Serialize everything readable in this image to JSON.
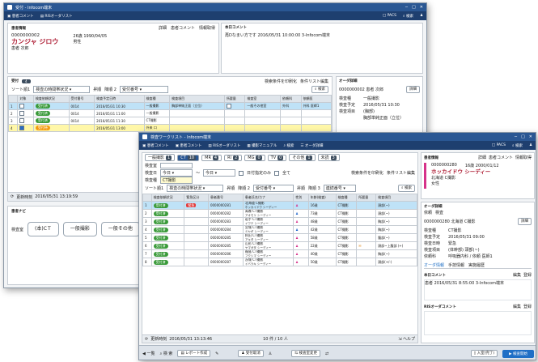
{
  "back": {
    "title": "受付 - Infocom端末",
    "toolbar": [
      "患者コメント",
      "RISオーダリスト"
    ],
    "toolbar_right": [
      "PACS",
      "検索",
      "ユーザ"
    ],
    "patient": {
      "section": "患者情報",
      "id": "0000000002",
      "name_kana": "カンジャ ジロウ",
      "name_kanji": "患者 次郎",
      "age_dob": "26歳 1990/04/05",
      "sex": "男性",
      "tabs": [
        "詳細",
        "患者コメント",
        "情報取得"
      ],
      "comment_header": "本日コメント",
      "comment_text": "再Dなまい方です 2016/05/31 10:00:00 3-Infocom端末"
    },
    "list": {
      "header": "受付",
      "badge": "4",
      "filter_label": "ソート順1",
      "filter_value": "検査の時間帯状況",
      "sort2": "昇順",
      "sort2b": "降順 2",
      "sort3": "受付番号",
      "print": "検索条件を印刷化",
      "cond": "条件リスト編集",
      "search": "検索",
      "columns": [
        "",
        "対象",
        "検査依頼状況",
        "受付番号",
        "検査予定日時",
        "検査種",
        "検査項目",
        "所要量",
        "検査室",
        "依頼科",
        "依頼医"
      ],
      "rows": [
        {
          "no": "1",
          "status": "受付済",
          "num": "0014",
          "time": "2016/05/31 10:30",
          "kind": "一般撮影",
          "item": "胸部単純正面（立位）",
          "dept": "一般その他室",
          "ward": "外科",
          "doc": "外科 医師1",
          "x": "20"
        },
        {
          "no": "2",
          "status": "受付済",
          "num": "0014",
          "time": "2016/05/31 11:00",
          "kind": "一般撮影",
          "item": "",
          "dept": "",
          "ward": "",
          "doc": "",
          "x": ""
        },
        {
          "no": "3",
          "status": "受付済",
          "num": "0014",
          "time": "2016/05/31 11:30",
          "kind": "CT撮影",
          "item": "",
          "dept": "",
          "ward": "",
          "doc": "",
          "x": ""
        },
        {
          "no": "4",
          "status": "受付待",
          "num": "",
          "time": "2016/05/31 13:00",
          "kind": "外来 口",
          "item": "",
          "dept": "",
          "ward": "",
          "doc": "",
          "x": ""
        }
      ],
      "footer_time": "2016/05/31 13:19:59",
      "footer_label": "更新時刻"
    },
    "navi": {
      "header": "患者ナビ",
      "label": "検査室",
      "buttons": [
        "(本)CＴ",
        "一般撮影",
        "一般その他"
      ]
    },
    "order": {
      "header": "オーダ詳細",
      "id": "0000000002 患者 次郎",
      "fields": [
        {
          "k": "検査種",
          "v": "一般撮影"
        },
        {
          "k": "検査予定",
          "v": "2016/05/31 10:30"
        },
        {
          "k": "検査項目",
          "v": "(胸部)"
        },
        {
          "k": "",
          "v": "胸部単純正面（立位）"
        }
      ],
      "detail_btn": "詳細"
    }
  },
  "front": {
    "title": "検査ワークリスト - Infocom端末",
    "toolbar": [
      "患者コメント",
      "患者コメント",
      "RISオーダリスト",
      "撮影マニュアル",
      "検索",
      "オーダ詳細"
    ],
    "toolbar_right": [
      "PACS",
      "検索",
      "ユーザ"
    ],
    "tabs": [
      "一般撮影",
      "CT",
      "MR",
      "RI",
      "MG",
      "TV",
      "その他",
      "未読"
    ],
    "active_tab": "CT",
    "tab_badges": [
      "1",
      "10",
      "4",
      "2",
      "0",
      "0",
      "1",
      "3"
    ],
    "print": "検索条件を印刷化",
    "cond": "条件リスト編集",
    "filters": {
      "room_label": "検査室",
      "date_label": "検査日",
      "date_from": "今日",
      "date_to": "今日",
      "date_tilde": "～",
      "kind_label": "検査種",
      "kind_value": "CT撮影",
      "only_today": "日付指定のみ",
      "all": "全て"
    },
    "sort": {
      "label": "ソート順1",
      "value": "検査の時間帯状況",
      "s2": "昇順",
      "s2b": "降順 2",
      "s3": "受付番号",
      "s3b": "昇順",
      "s4": "降順 3",
      "s5": "連続番号",
      "search": "検索"
    },
    "columns": [
      "",
      "検査依頼状況",
      "緊急区分",
      "患者番号",
      "患者氏名/カナ",
      "性別",
      "年齢(検査)",
      "検査種",
      "所要量",
      "検査項目"
    ],
    "rows": [
      {
        "no": "1",
        "status": "受付済",
        "urgent": "緊急",
        "id": "0000000281",
        "name": "北海道 C撮影",
        "kana": "ホッカイドウ シーディー",
        "sex": "F",
        "age": "16歳",
        "kind": "CT撮影",
        "item": "頭部(~)",
        "sel": true
      },
      {
        "no": "2",
        "status": "受付済",
        "urgent": "",
        "id": "0000000282",
        "name": "青森 CT撮影",
        "kana": "アオモリ シーディー",
        "sex": "M",
        "age": "73歳",
        "kind": "CT撮影",
        "item": "頭部(~)",
        "sel": false
      },
      {
        "no": "3",
        "status": "受付済",
        "urgent": "",
        "id": "0000000283",
        "name": "岩手 CT撮影",
        "kana": "イワテ シーディー",
        "sex": "F",
        "age": "48歳",
        "kind": "CT撮影",
        "item": "胸部(~)",
        "sel": false
      },
      {
        "no": "4",
        "status": "受付済",
        "urgent": "",
        "id": "0000000284",
        "name": "宮城 CT撮影",
        "kana": "ミヤギ シーディー",
        "sex": "M",
        "age": "42歳",
        "kind": "CT撮影",
        "item": "胸部(~)",
        "sel": false
      },
      {
        "no": "5",
        "status": "受付済",
        "urgent": "",
        "id": "0000000285",
        "name": "秋田 CT撮影",
        "kana": "アキタ シーディー",
        "sex": "F",
        "age": "58歳",
        "kind": "CT撮影",
        "item": "腹部(~)",
        "sel": false
      },
      {
        "no": "6",
        "status": "受付済",
        "urgent": "",
        "id": "0000000285",
        "name": "山形 CT撮影",
        "kana": "ヤマガタ シーディー",
        "sex": "F",
        "age": "22歳",
        "kind": "CT撮影",
        "item": "頭部~上腹部 (+)",
        "sel": false
      },
      {
        "no": "7",
        "status": "受付済",
        "urgent": "",
        "id": "0000000286",
        "name": "福島 CT撮影",
        "kana": "フクシマ シーディー",
        "sex": "F",
        "age": "40歳",
        "kind": "CT撮影",
        "item": "胸部(~)",
        "sel": false
      },
      {
        "no": "8",
        "status": "受付済",
        "urgent": "",
        "id": "0000000287",
        "name": "茨城 CT撮影",
        "kana": "イバラキ シーディー",
        "sex": "F",
        "age": "50歳",
        "kind": "CT撮影",
        "item": "頭部(+/-)",
        "sel": false
      }
    ],
    "footer": {
      "label": "更新時刻",
      "time": "2016/05/31 13:13:46",
      "count": "10 件 / 10 人",
      "help": "ヘルプ"
    },
    "bottom_bar": [
      "一覧",
      "検 索",
      "レポート作成",
      "受付取消",
      "検査室変更",
      "入室(完了)",
      "検査開始"
    ],
    "patient": {
      "section": "患者情報",
      "tabs": [
        "詳細",
        "患者コメント",
        "情報取得"
      ],
      "id": "0000000280",
      "age_dob": "16歳 2000/01/12",
      "name_kana": "ホッカイドウ シーディー",
      "name_kanji": "北海道 C撮影",
      "sex": "女性"
    },
    "order": {
      "header": "オーダ詳細",
      "subtabs": [
        "依頼",
        "検査"
      ],
      "id": "0000000280 北海道 C撮影",
      "detail_btn": "詳細",
      "fields": [
        {
          "k": "検査種",
          "v": "CT撮影"
        },
        {
          "k": "検査予定",
          "v": "2016/05/31 09:00"
        },
        {
          "k": "検査日時",
          "v": "緊急"
        },
        {
          "k": "検査項目",
          "v": "(体幹部) 頭部(~)"
        },
        {
          "k": "依頼科",
          "v": "呼吸器内科 / 依頼 医師1"
        }
      ],
      "subtabs2": [
        "オーダ情報",
        "手技情報",
        "実施履歴"
      ],
      "comment_header": "本日コメント",
      "comment_text": "患者 2016/05/31 8:55:00 3-Infocom端末",
      "ris_header": "RISオーダコメント",
      "edit": "編集",
      "register": "登録"
    }
  }
}
